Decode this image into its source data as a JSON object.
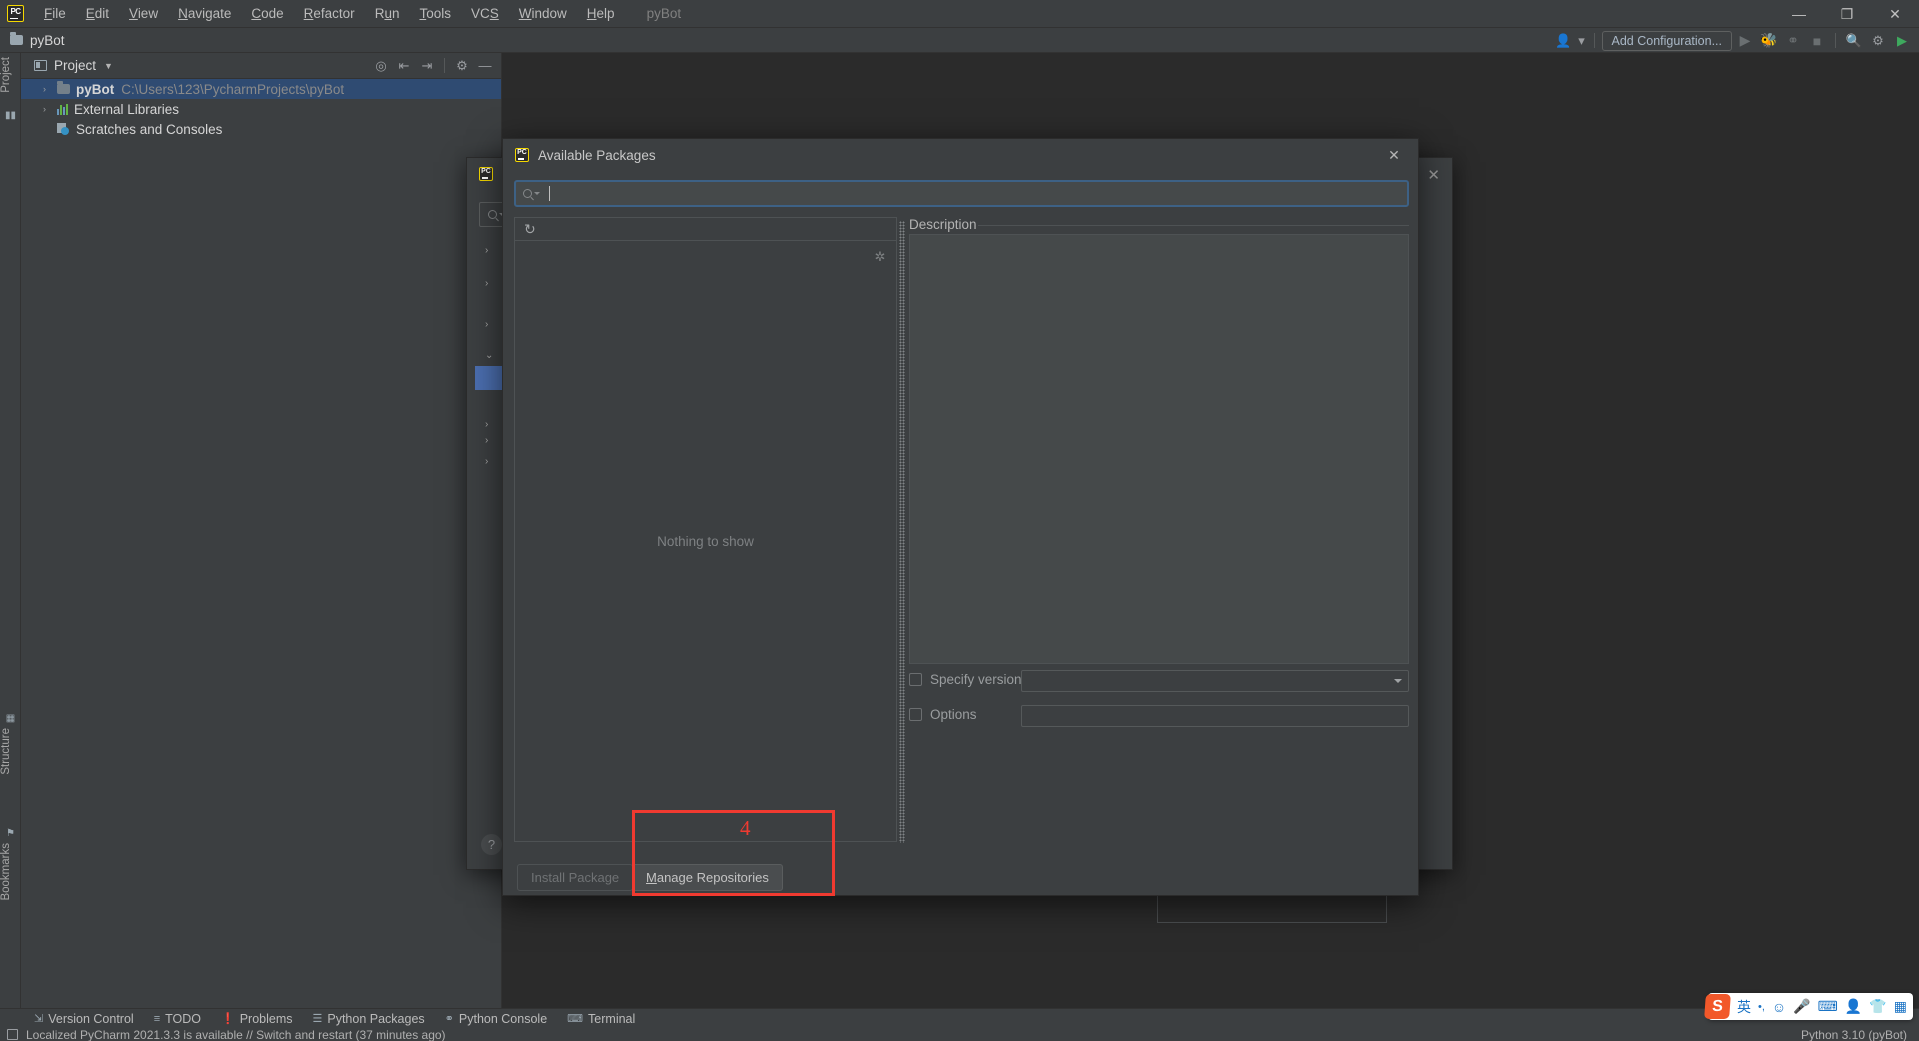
{
  "window": {
    "title": "pyBot",
    "minimize": "—",
    "maximize": "❐",
    "close": "✕"
  },
  "menu": {
    "items": [
      {
        "label": "File"
      },
      {
        "label": "Edit"
      },
      {
        "label": "View"
      },
      {
        "label": "Navigate"
      },
      {
        "label": "Code"
      },
      {
        "label": "Refactor"
      },
      {
        "label": "Run"
      },
      {
        "label": "Tools"
      },
      {
        "label": "VCS"
      },
      {
        "label": "Window"
      },
      {
        "label": "Help"
      }
    ]
  },
  "navbar": {
    "project_name": "pyBot",
    "add_configuration": "Add Configuration...",
    "icons": [
      "user-icon",
      "chevron-down-icon",
      "run-icon",
      "debug-icon",
      "coverage-icon",
      "stop-icon",
      "search-everywhere-icon",
      "settings-icon",
      "updates-icon"
    ]
  },
  "left_strip": {
    "top_tabs": [
      {
        "label": "Project",
        "icon": "project-icon"
      },
      {
        "label": "",
        "icon": "folder-icon"
      }
    ],
    "bottom_tabs": [
      {
        "label": "Structure",
        "icon": "structure-icon"
      },
      {
        "label": "Bookmarks",
        "icon": "bookmark-icon"
      }
    ]
  },
  "project_panel": {
    "title": "Project",
    "toolbar_icons": [
      "locate-icon",
      "expand-all-icon",
      "collapse-all-icon",
      "gear-icon",
      "hide-icon"
    ],
    "tree": [
      {
        "name": "pyBot",
        "path": "C:\\Users\\123\\PycharmProjects\\pyBot",
        "icon": "folder-icon",
        "arrow": "›",
        "bold": true,
        "selected": true
      },
      {
        "name": "External Libraries",
        "path": "",
        "icon": "library-icon",
        "arrow": "›",
        "bold": false,
        "selected": false
      },
      {
        "name": "Scratches and Consoles",
        "path": "",
        "icon": "scratches-icon",
        "arrow": "",
        "bold": false,
        "selected": false
      }
    ]
  },
  "dialog": {
    "title": "Available Packages",
    "close_label": "✕",
    "search": {
      "value": "",
      "placeholder": "",
      "icon": "search-icon"
    },
    "list": {
      "refresh_icon": "refresh-icon",
      "empty_text": "Nothing to show",
      "loading_icon": "loading-spinner-icon"
    },
    "description": {
      "label": "Description",
      "content": ""
    },
    "specify_version": {
      "label": "Specify version",
      "checked": false,
      "value": ""
    },
    "options": {
      "label": "Options",
      "checked": false,
      "value": ""
    },
    "buttons": {
      "install": "Install Package",
      "install_disabled": true,
      "manage_mnemonic": "M",
      "manage_rest": "anage Repositories"
    }
  },
  "background_dialog": {
    "close_label": "✕",
    "help_label": "?"
  },
  "annotation": {
    "number": "4"
  },
  "bottom_bar": {
    "tabs": [
      {
        "label": "Version Control",
        "icon": "branch-icon"
      },
      {
        "label": "TODO",
        "icon": "list-icon"
      },
      {
        "label": "Problems",
        "icon": "warning-icon"
      },
      {
        "label": "Python Packages",
        "icon": "packages-icon"
      },
      {
        "label": "Python Console",
        "icon": "python-icon"
      },
      {
        "label": "Terminal",
        "icon": "terminal-icon"
      }
    ]
  },
  "status_bar": {
    "message": "Localized PyCharm 2021.3.3 is available // Switch and restart (37 minutes ago)",
    "interpreter": "Python 3.10 (pyBot)",
    "icon": "notification-icon"
  },
  "ime": {
    "logo": "S",
    "items": [
      "英",
      "•,",
      "☺",
      "🎤",
      "⌨",
      "👤",
      "👕",
      "▦"
    ]
  },
  "colors": {
    "accent_blue": "#4b6eaf",
    "annotation_red": "#f03a30",
    "panel_bg": "#3c3f41",
    "editor_bg": "#2b2b2b",
    "selection": "#2f4b72",
    "text": "#bbbbbb"
  }
}
